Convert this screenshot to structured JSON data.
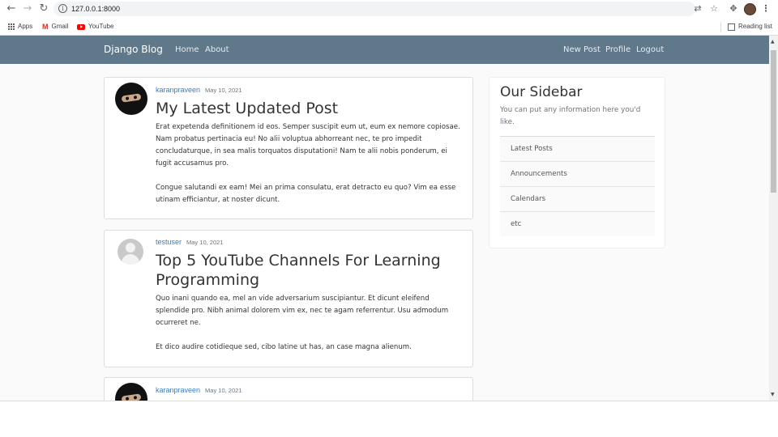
{
  "browser": {
    "url": "127.0.0.1:8000",
    "bookmarks": [
      "Apps",
      "Gmail",
      "YouTube"
    ],
    "reading_list": "Reading list"
  },
  "site": {
    "brand": "Django Blog",
    "nav_left": [
      "Home",
      "About"
    ],
    "nav_right": [
      "New Post",
      "Profile",
      "Logout"
    ]
  },
  "posts": [
    {
      "author": "karanpraveen",
      "date": "May 10, 2021",
      "title": "My Latest Updated Post",
      "paragraphs": [
        "Erat expetenda definitionem id eos. Semper suscipit eum ut, eum ex nemore copiosae. Nam probatus pertinacia eu! No alii voluptua abhorreant nec, te pro impedit concludaturque, in sea malis torquatos disputationi! Nam te alii nobis ponderum, ei fugit accusamus pro.",
        "Congue salutandi ex eam! Mei an prima consulatu, erat detracto eu quo? Vim ea esse utinam efficiantur, at noster dicunt."
      ]
    },
    {
      "author": "testuser",
      "date": "May 10, 2021",
      "title": "Top 5 YouTube Channels For Learning Programming",
      "paragraphs": [
        "Quo inani quando ea, mel an vide adversarium suscipiantur. Et dicunt eleifend splendide pro. Nibh animal dolorem vim ex, nec te agam referrentur. Usu admodum ocurreret ne.",
        "Et dico audire cotidieque sed, cibo latine ut has, an case magna alienum."
      ]
    },
    {
      "author": "karanpraveen",
      "date": "May 10, 2021"
    }
  ],
  "sidebar": {
    "title": "Our Sidebar",
    "text": "You can put any information here you'd like.",
    "items": [
      "Latest Posts",
      "Announcements",
      "Calendars",
      "etc"
    ]
  }
}
